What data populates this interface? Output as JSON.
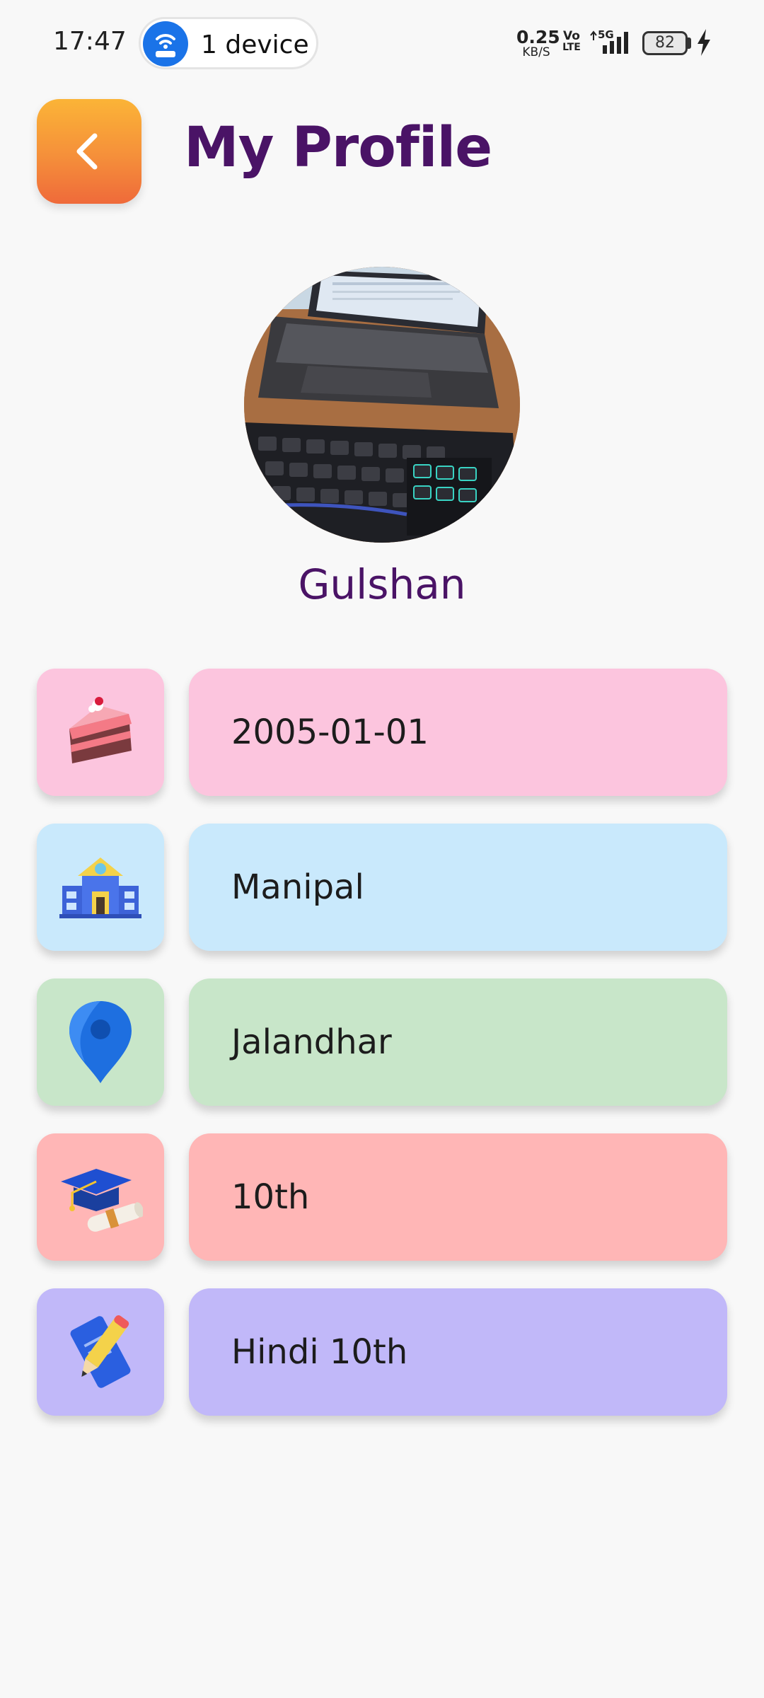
{
  "status_bar": {
    "time": "17:47",
    "hotspot_label": "1 device",
    "net_speed_value": "0.25",
    "net_speed_unit": "KB/S",
    "volte_top": "Vo",
    "volte_bottom": "LTE",
    "network_type": "5G",
    "battery_level": "82"
  },
  "header": {
    "title": "My Profile",
    "back_icon": "chevron-left-icon"
  },
  "profile": {
    "name": "Gulshan",
    "avatar_description": "laptop-and-keyboard-photo"
  },
  "details": [
    {
      "icon": "birthday-cake-icon",
      "value": "2005-01-01",
      "tile_color": "#fcc5de",
      "card_color": "#fcc5de"
    },
    {
      "icon": "school-building-icon",
      "value": "Manipal",
      "tile_color": "#c9e9fc",
      "card_color": "#c9e9fc"
    },
    {
      "icon": "location-pin-icon",
      "value": "Jalandhar",
      "tile_color": "#c8e6c9",
      "card_color": "#c8e6c9"
    },
    {
      "icon": "graduation-cap-icon",
      "value": "10th",
      "tile_color": "#ffb6b6",
      "card_color": "#ffb6b6"
    },
    {
      "icon": "pencil-notes-icon",
      "value": "Hindi 10th",
      "tile_color": "#c1b8f9",
      "card_color": "#c1b8f9"
    }
  ],
  "colors": {
    "title": "#4a1366",
    "background": "#f8f8f8",
    "back_button_top": "#fbb437",
    "back_button_bottom": "#ef6a3a"
  }
}
